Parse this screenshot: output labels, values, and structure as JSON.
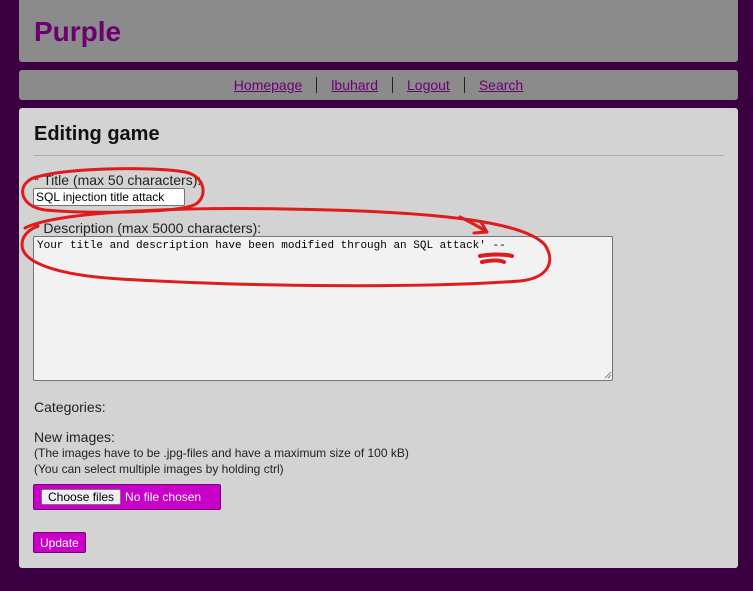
{
  "header": {
    "site_title": "Purple"
  },
  "nav": {
    "items": [
      {
        "label": "Homepage"
      },
      {
        "label": "lbuhard"
      },
      {
        "label": "Logout"
      },
      {
        "label": "Search"
      }
    ]
  },
  "form": {
    "page_title": "Editing game",
    "title_label": "* Title (max 50 characters):",
    "title_value": "SQL injection title attack",
    "description_label": "* Description (max 5000 characters):",
    "description_value": "Your title and description have been modified through an SQL attack' --",
    "categories_label": "Categories:",
    "new_images_label": "New images:",
    "images_hint_1": "(The images have to be .jpg-files and have a maximum size of 100 kB)",
    "images_hint_2": "(You can select multiple images by holding ctrl)",
    "choose_files_label": "Choose files",
    "no_file_label": "No file chosen",
    "update_label": "Update"
  },
  "colors": {
    "page_background": "#3a0040",
    "panel_gray": "#8b8b8b",
    "content_gray": "#d3d3d3",
    "brand_purple": "#6c0070",
    "button_magenta": "#c800c8",
    "annotation_red": "#e01b1b"
  }
}
